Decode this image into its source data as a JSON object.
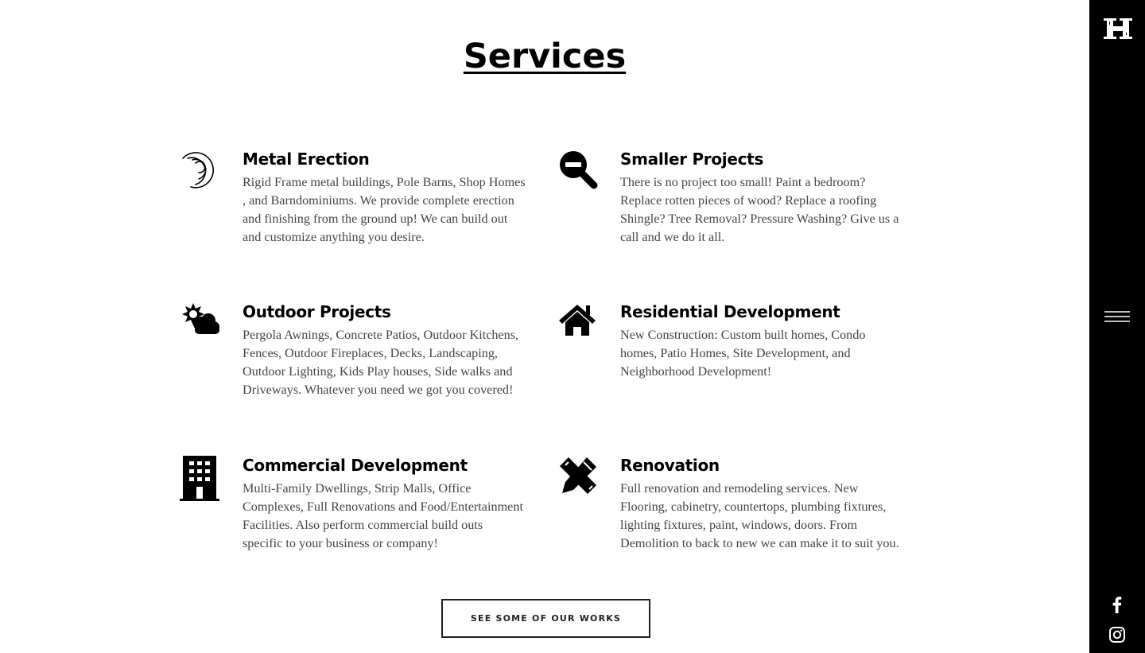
{
  "page": {
    "title": "Services"
  },
  "services": [
    {
      "title": "Metal Erection",
      "description": "Rigid Frame metal buildings, Pole Barns, Shop Homes , and Barndominiums. We provide complete erection and finishing from the ground up! We can build out and customize anything you desire.",
      "icon": "concentric-arcs-icon"
    },
    {
      "title": "Smaller Projects",
      "description": "There is no project too small! Paint a bedroom? Replace rotten pieces of wood? Replace a roofing Shingle? Tree Removal? Pressure Washing? Give us a call and we do it all.",
      "icon": "search-minus-icon"
    },
    {
      "title": "Outdoor Projects",
      "description": "Pergola Awnings, Concrete Patios, Outdoor Kitchens, Fences, Outdoor Fireplaces, Decks, Landscaping, Outdoor Lighting, Kids Play houses, Side walks and Driveways. Whatever you need we got you covered!",
      "icon": "cloud-sun-icon"
    },
    {
      "title": "Residential Development",
      "description": "New Construction: Custom built homes, Condo homes, Patio Homes, Site Development, and Neighborhood Development!",
      "icon": "house-icon"
    },
    {
      "title": "Commercial Development",
      "description": "Multi-Family Dwellings, Strip Malls, Office Complexes, Full Renovations and Food/Entertainment Facilities. Also perform commercial build outs specific to your business or company!",
      "icon": "office-building-icon"
    },
    {
      "title": "Renovation",
      "description": "Full renovation and remodeling services. New Flooring, cabinetry, countertops, plumbing fixtures, lighting fixtures, paint, windows, doors. From Demolition to back to new we can make it to suit you.",
      "icon": "pencil-ruler-icon"
    }
  ],
  "cta": {
    "label": "SEE SOME OF OUR WORKS"
  },
  "sidebar": {
    "logo_letter": "H",
    "menu_icon": "hamburger-menu-icon",
    "social": [
      "facebook-icon",
      "instagram-icon"
    ]
  },
  "colors": {
    "sidebar_bg": "#000000",
    "heading": "#000000",
    "body_text": "#444444",
    "button_border": "#222222"
  }
}
